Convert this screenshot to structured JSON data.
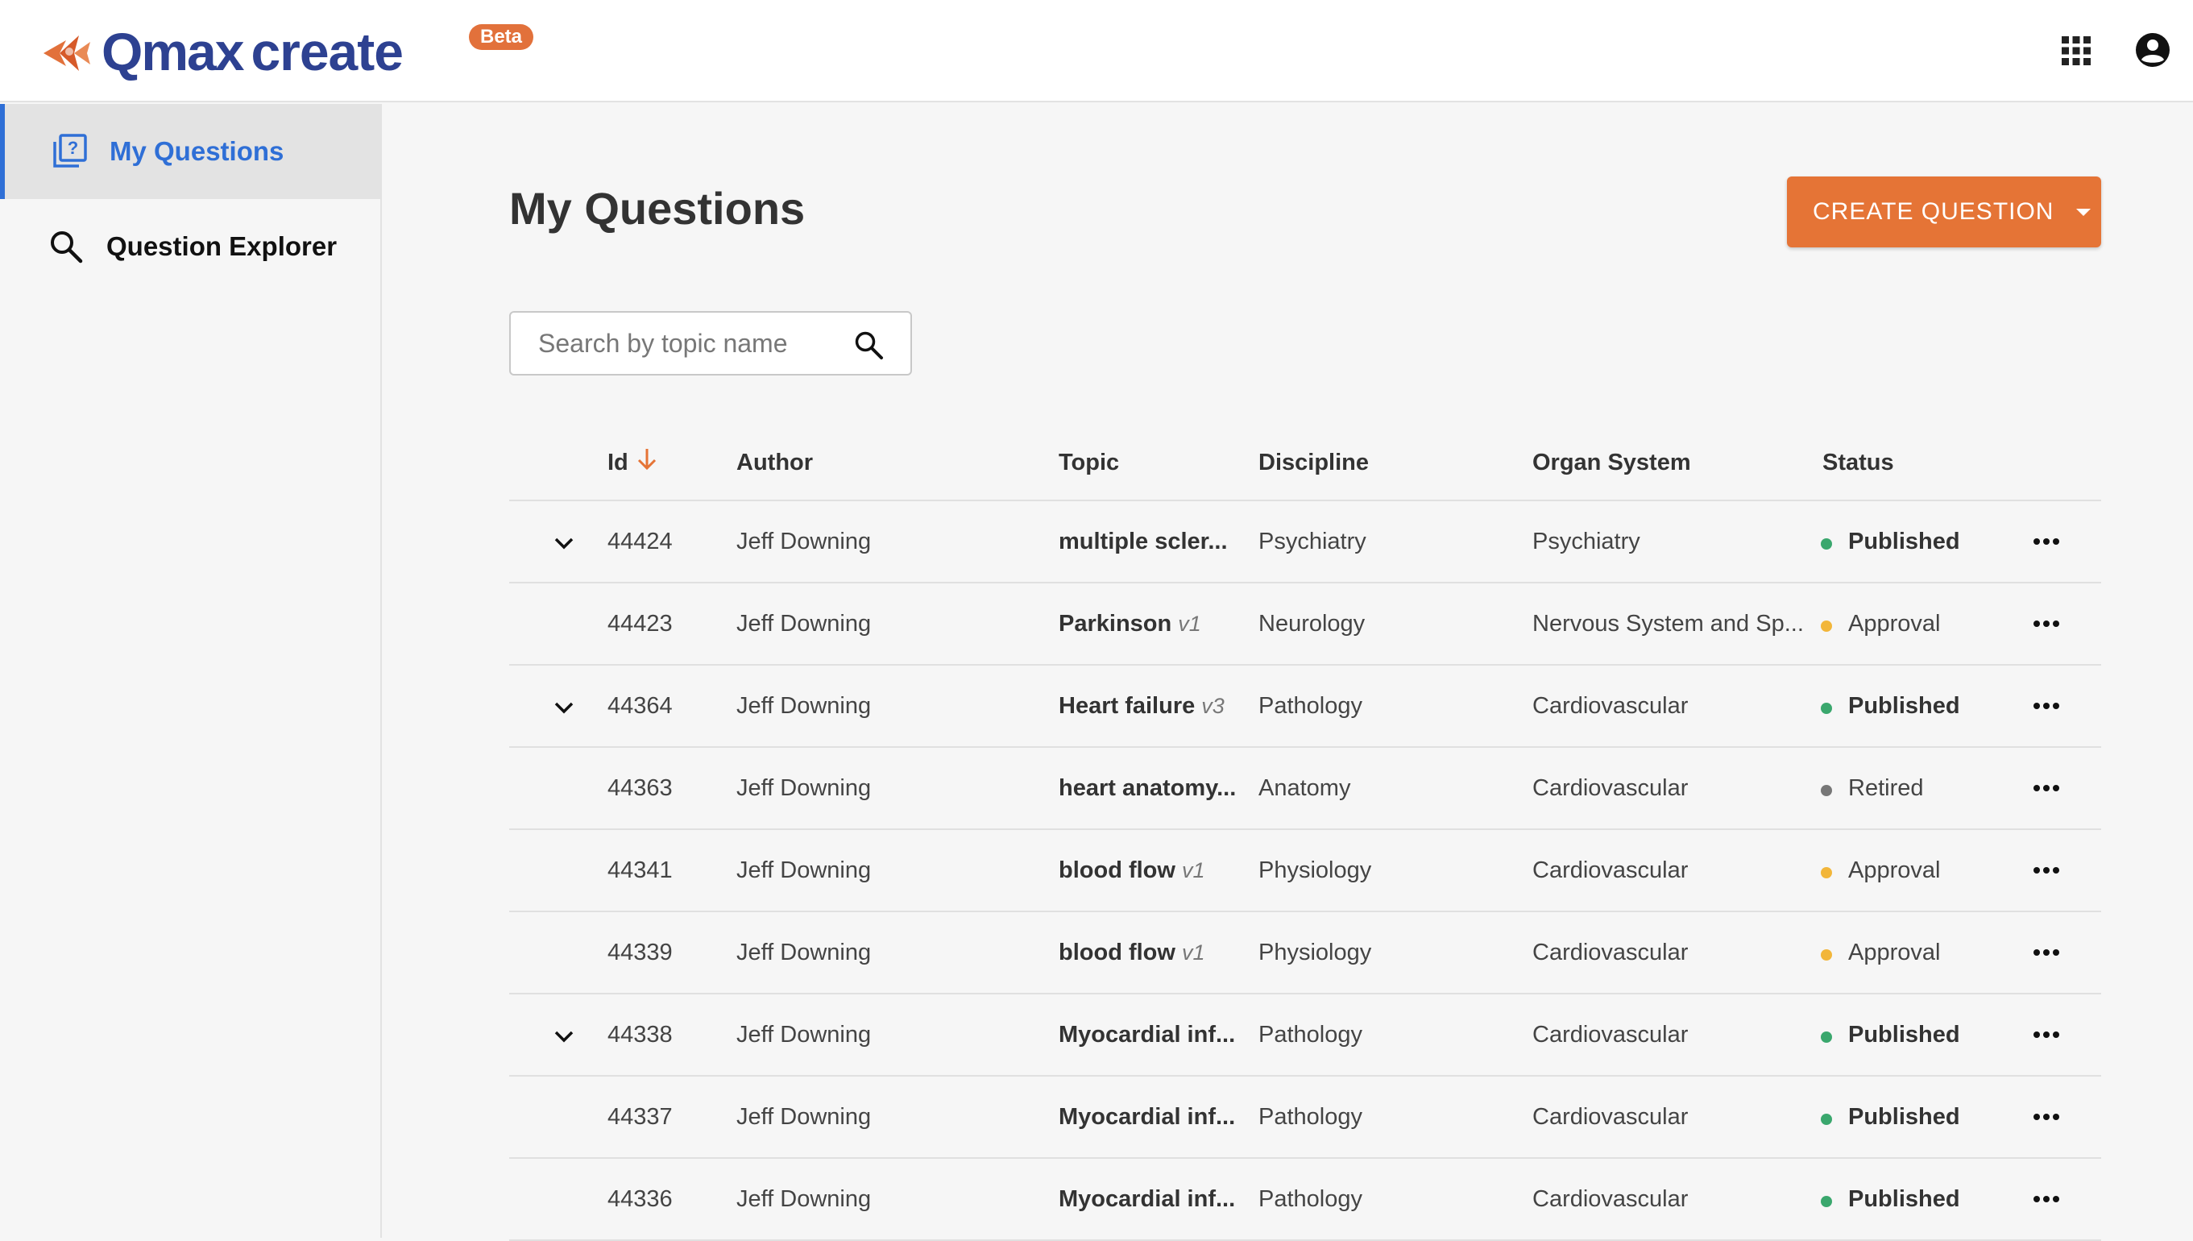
{
  "brand": {
    "logo_q": "Qmax",
    "logo_create": "create",
    "badge": "Beta",
    "colors": {
      "primary": "#2d4191",
      "accent": "#e57436",
      "nav_active": "#2f6fd6"
    }
  },
  "header": {
    "apps_icon": "grid-apps-icon",
    "account_icon": "account-circle-icon"
  },
  "sidebar": {
    "items": [
      {
        "label": "My Questions",
        "icon": "question-library-icon",
        "active": true
      },
      {
        "label": "Question Explorer",
        "icon": "search-icon",
        "active": false
      }
    ]
  },
  "main": {
    "title": "My Questions",
    "create_button": "CREATE QUESTION",
    "search": {
      "placeholder": "Search by topic name",
      "value": ""
    }
  },
  "table": {
    "columns": [
      "Id",
      "Author",
      "Topic",
      "Discipline",
      "Organ System",
      "Status"
    ],
    "sort": {
      "column": "Id",
      "direction": "desc"
    },
    "status_colors": {
      "Published": "#3aa76d",
      "Approval": "#f2b63a",
      "Retired": "#777777"
    },
    "rows": [
      {
        "expandable": true,
        "id": "44424",
        "author": "Jeff Downing",
        "topic": "multiple scler...",
        "version": "",
        "discipline": "Psychiatry",
        "organ": "Psychiatry",
        "status": "Published"
      },
      {
        "expandable": false,
        "id": "44423",
        "author": "Jeff Downing",
        "topic": "Parkinson",
        "version": "v1",
        "discipline": "Neurology",
        "organ": "Nervous System and Sp...",
        "status": "Approval"
      },
      {
        "expandable": true,
        "id": "44364",
        "author": "Jeff Downing",
        "topic": "Heart failure",
        "version": "v3",
        "discipline": "Pathology",
        "organ": "Cardiovascular",
        "status": "Published"
      },
      {
        "expandable": false,
        "id": "44363",
        "author": "Jeff Downing",
        "topic": "heart anatomy...",
        "version": "",
        "discipline": "Anatomy",
        "organ": "Cardiovascular",
        "status": "Retired"
      },
      {
        "expandable": false,
        "id": "44341",
        "author": "Jeff Downing",
        "topic": "blood flow",
        "version": "v1",
        "discipline": "Physiology",
        "organ": "Cardiovascular",
        "status": "Approval"
      },
      {
        "expandable": false,
        "id": "44339",
        "author": "Jeff Downing",
        "topic": "blood flow",
        "version": "v1",
        "discipline": "Physiology",
        "organ": "Cardiovascular",
        "status": "Approval"
      },
      {
        "expandable": true,
        "id": "44338",
        "author": "Jeff Downing",
        "topic": "Myocardial inf...",
        "version": "",
        "discipline": "Pathology",
        "organ": "Cardiovascular",
        "status": "Published"
      },
      {
        "expandable": false,
        "id": "44337",
        "author": "Jeff Downing",
        "topic": "Myocardial inf...",
        "version": "",
        "discipline": "Pathology",
        "organ": "Cardiovascular",
        "status": "Published"
      },
      {
        "expandable": false,
        "id": "44336",
        "author": "Jeff Downing",
        "topic": "Myocardial inf...",
        "version": "",
        "discipline": "Pathology",
        "organ": "Cardiovascular",
        "status": "Published"
      }
    ]
  }
}
